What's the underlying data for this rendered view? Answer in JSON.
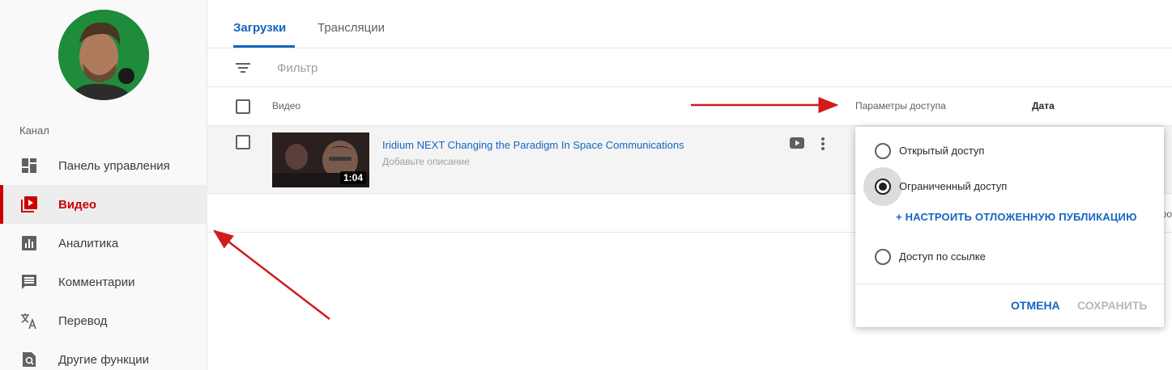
{
  "sidebar": {
    "section_label": "Канал",
    "items": [
      {
        "label": "Панель управления",
        "icon": "dashboard-icon"
      },
      {
        "label": "Видео",
        "icon": "video-library-icon",
        "active": true
      },
      {
        "label": "Аналитика",
        "icon": "analytics-icon"
      },
      {
        "label": "Комментарии",
        "icon": "comments-icon"
      },
      {
        "label": "Перевод",
        "icon": "translate-icon"
      },
      {
        "label": "Другие функции",
        "icon": "other-features-icon"
      }
    ]
  },
  "tabs": [
    {
      "label": "Загрузки",
      "active": true
    },
    {
      "label": "Трансляции"
    }
  ],
  "filter": {
    "placeholder": "Фильтр"
  },
  "table": {
    "headers": {
      "video": "Видео",
      "access": "Параметры доступа",
      "date": "Дата"
    },
    "rows": [
      {
        "title": "Iridium NEXT Changing the Paradigm In Space Communications",
        "description": "Добавьте описание",
        "duration": "1:04"
      }
    ],
    "clipped_text": "ро"
  },
  "access_popup": {
    "options": [
      {
        "label": "Открытый доступ",
        "checked": false
      },
      {
        "label": "Ограниченный доступ",
        "checked": true
      },
      {
        "label": "Доступ по ссылке",
        "checked": false
      }
    ],
    "schedule_link": "+ НАСТРОИТЬ ОТЛОЖЕННУЮ ПУБЛИКАЦИЮ",
    "cancel_label": "ОТМЕНА",
    "save_label": "СОХРАНИТЬ"
  },
  "colors": {
    "accent_blue": "#1565c0",
    "active_red": "#cc0000",
    "arrow_red": "#d11a1a"
  }
}
